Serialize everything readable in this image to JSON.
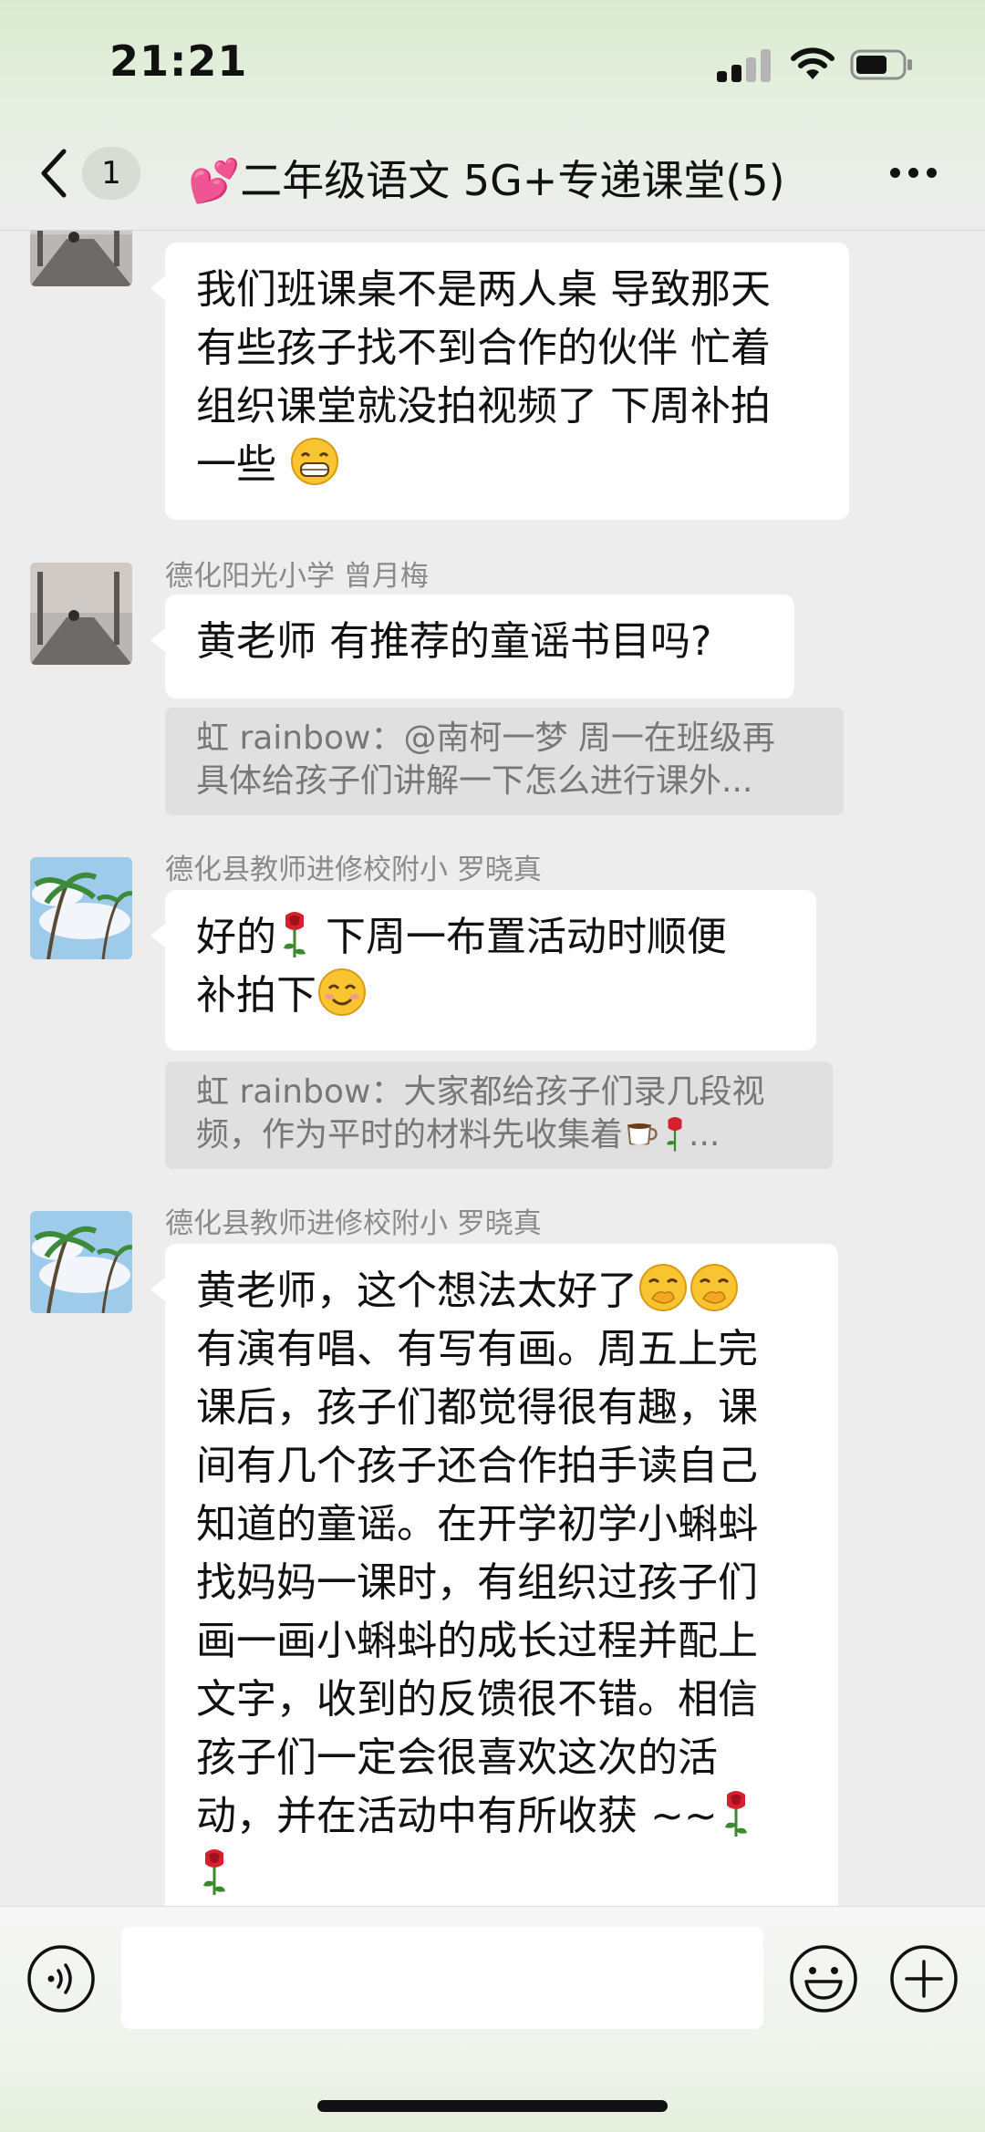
{
  "status_bar": {
    "time": "21:21",
    "icons": [
      "cellular-signal-icon",
      "wifi-icon",
      "battery-icon"
    ]
  },
  "header": {
    "back_icon": "chevron-left-icon",
    "unread_count": "1",
    "title_emoji": "💕",
    "title": "二年级语文 5G+专递课堂(5)",
    "more_icon": "ellipsis-icon"
  },
  "messages": [
    {
      "sender": "",
      "lines": [
        "我们班课桌不是两人桌 导致那天",
        "有些孩子找不到合作的伙伴 忙着",
        "组织课堂就没拍视频了 下周补拍",
        "一些"
      ],
      "emoji": "grin-face-icon"
    },
    {
      "sender": "德化阳光小学 曾月梅",
      "lines": [
        "黄老师 有推荐的童谣书目吗?"
      ],
      "quote": [
        "虹 rainbow：@南柯一梦 周一在班级再",
        "具体给孩子们讲解一下怎么进行课外..."
      ]
    },
    {
      "sender": "德化县教师进修校附小 罗晓真",
      "lines": [
        "好的",
        " 下周一布置活动时顺便",
        "补拍下"
      ],
      "quote": [
        "虹 rainbow：大家都给孩子们录几段视",
        "频，作为平时的材料先收集着",
        "..."
      ]
    },
    {
      "sender": "德化县教师进修校附小 罗晓真",
      "lines": [
        "黄老师，这个想法太好了",
        "有演有唱、有写有画。周五上完",
        "课后，孩子们都觉得很有趣，课",
        "间有几个孩子还合作拍手读自己",
        "知道的童谣。在开学初学小蝌蚪",
        "找妈妈一课时，有组织过孩子们",
        "画一画小蝌蚪的成长过程并配上",
        "文字，收到的反馈很不错。相信",
        "孩子们一定会很喜欢这次的活",
        "动，并在活动中有所收获 ~~"
      ]
    }
  ],
  "input_bar": {
    "voice_icon": "voice-icon",
    "input_value": "",
    "emoji_icon": "emoji-icon",
    "plus_icon": "plus-icon"
  },
  "colors": {
    "header_tint": "#d9ebcf",
    "chat_background": "#ededed",
    "bubble": "#ffffff",
    "quote_background": "#e0e0e0",
    "sender_text": "#8a8a8a"
  }
}
